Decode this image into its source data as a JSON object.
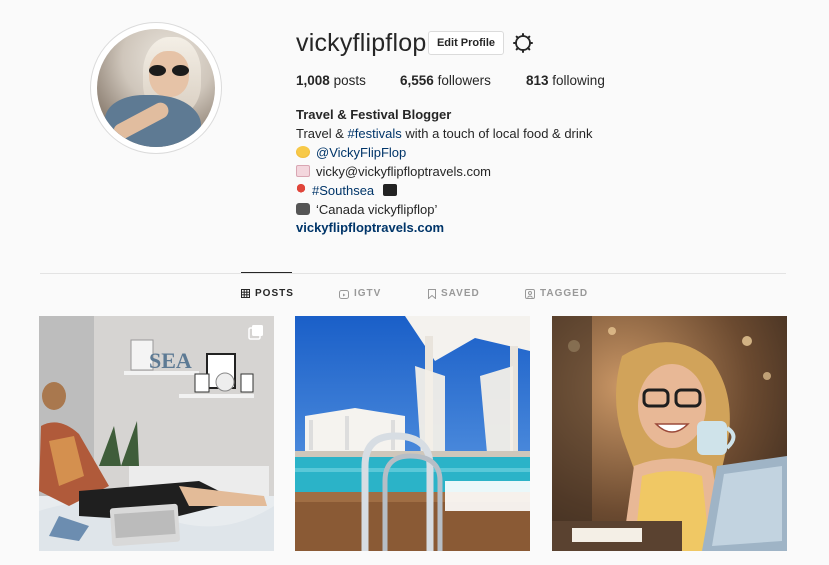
{
  "profile": {
    "username": "vickyflipflop",
    "edit_label": "Edit Profile",
    "stats": {
      "posts_count": "1,008",
      "posts_label": "posts",
      "followers_count": "6,556",
      "followers_label": "followers",
      "following_count": "813",
      "following_label": "following"
    },
    "bio": {
      "name": "Travel & Festival Blogger",
      "line1_prefix": "Travel & ",
      "line1_hashtag": "#festivals",
      "line1_suffix": " with a touch of local food & drink",
      "handle": "@VickyFlipFlop",
      "email": "vicky@vickyflipfloptravels.com",
      "location_tag": "#Southsea",
      "video_line": "‘Canada vickyflipflop’",
      "website": "vickyflipfloptravels.com"
    }
  },
  "tabs": [
    {
      "label": "POSTS",
      "icon": "grid-icon",
      "active": true
    },
    {
      "label": "IGTV",
      "icon": "igtv-icon",
      "active": false
    },
    {
      "label": "SAVED",
      "icon": "bookmark-icon",
      "active": false
    },
    {
      "label": "TAGGED",
      "icon": "tag-icon",
      "active": false
    }
  ],
  "posts": [
    {
      "subject": "woman-on-bed-with-laptop",
      "multi": true
    },
    {
      "subject": "cruise-ship-pool-cabanas",
      "multi": false
    },
    {
      "subject": "smiling-woman-with-mug-and-laptop",
      "multi": false
    }
  ],
  "colors": {
    "background": "#fafafa",
    "text": "#262626",
    "link": "#003569",
    "tab_inactive": "#999999",
    "divider": "#dbdbdb"
  }
}
